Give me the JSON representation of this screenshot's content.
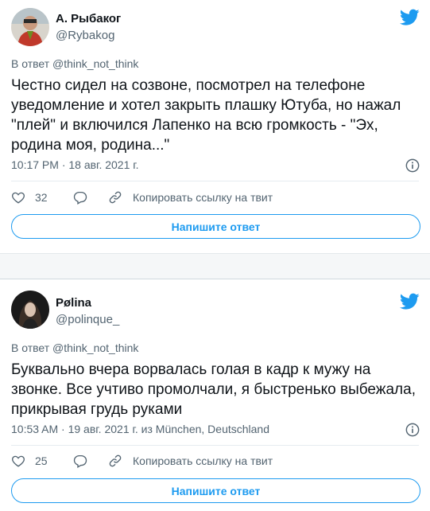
{
  "tweets": [
    {
      "display_name": "А. Рыбаког",
      "handle": "@Rybakog",
      "reply_to": "В ответ @think_not_think",
      "text": "Честно сидел на созвоне, посмотрел на телефоне уведомление и хотел закрыть плашку Ютуба, но нажал \"плей\" и включился Лапенко на всю громкость - \"Эх, родина моя, родина...\"",
      "meta": "10:17 PM · 18 авг. 2021 г.",
      "likes": "32",
      "copy_link": "Копировать ссылку на твит",
      "reply_button": "Напишите ответ"
    },
    {
      "display_name": "Pølina",
      "handle": "@polinque_",
      "reply_to": "В ответ @think_not_think",
      "text": "Буквально вчера ворвалась голая в кадр к мужу на звонке. Все учтиво промолчали, я быстренько выбежала, прикрывая грудь руками",
      "meta": "10:53 AM · 19 авг. 2021 г. из München, Deutschland",
      "likes": "25",
      "copy_link": "Копировать ссылку на твит",
      "reply_button": "Напишите ответ"
    }
  ],
  "colors": {
    "accent": "#1d9bf0",
    "muted": "#536471",
    "text": "#0f1419"
  },
  "icons": [
    "twitter-bird-icon",
    "info-icon",
    "heart-icon",
    "reply-icon",
    "link-icon"
  ]
}
